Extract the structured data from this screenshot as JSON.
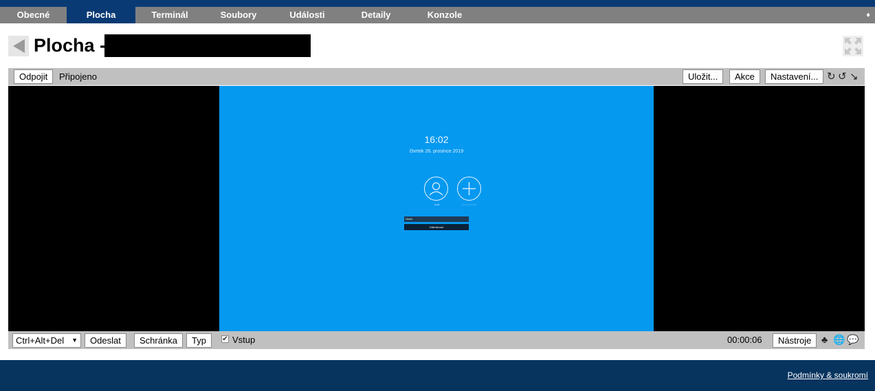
{
  "tabs": [
    {
      "label": "Obecné",
      "active": false
    },
    {
      "label": "Plocha",
      "active": true
    },
    {
      "label": "Terminál",
      "active": false
    },
    {
      "label": "Soubory",
      "active": false
    },
    {
      "label": "Události",
      "active": false
    },
    {
      "label": "Detaily",
      "active": false
    },
    {
      "label": "Konzole",
      "active": false
    }
  ],
  "tab_more_glyph": "♦",
  "page": {
    "title": "Plocha -"
  },
  "top_toolbar": {
    "disconnect_label": "Odpojit",
    "status": "Připojeno",
    "save_label": "Uložit...",
    "actions_label": "Akce",
    "settings_label": "Nastavení...",
    "rotate_cw_glyph": "↻",
    "rotate_ccw_glyph": "↺",
    "resize_glyph": "↘"
  },
  "remote_screen": {
    "time": "16:02",
    "date": "čtvrtek 26. prosince 2019",
    "user_label": "root",
    "other_user_label": "Jiný uživatel",
    "password_placeholder": "Heslo",
    "login_button": "Odemknout"
  },
  "bottom_toolbar": {
    "keys_select_value": "Ctrl+Alt+Del",
    "send_label": "Odeslat",
    "clipboard_label": "Schránka",
    "type_label": "Typ",
    "input_label": "Vstup",
    "input_checked": true,
    "timer": "00:00:06",
    "tools_label": "Nástroje",
    "tree_glyph": "♣",
    "globe_glyph": "🌐",
    "chat_glyph": "💬"
  },
  "footer": {
    "link": "Podmínky & soukromí"
  },
  "colors": {
    "navy": "#0a3a74",
    "tab_gray": "#808080",
    "remote_blue": "#0699f0"
  }
}
